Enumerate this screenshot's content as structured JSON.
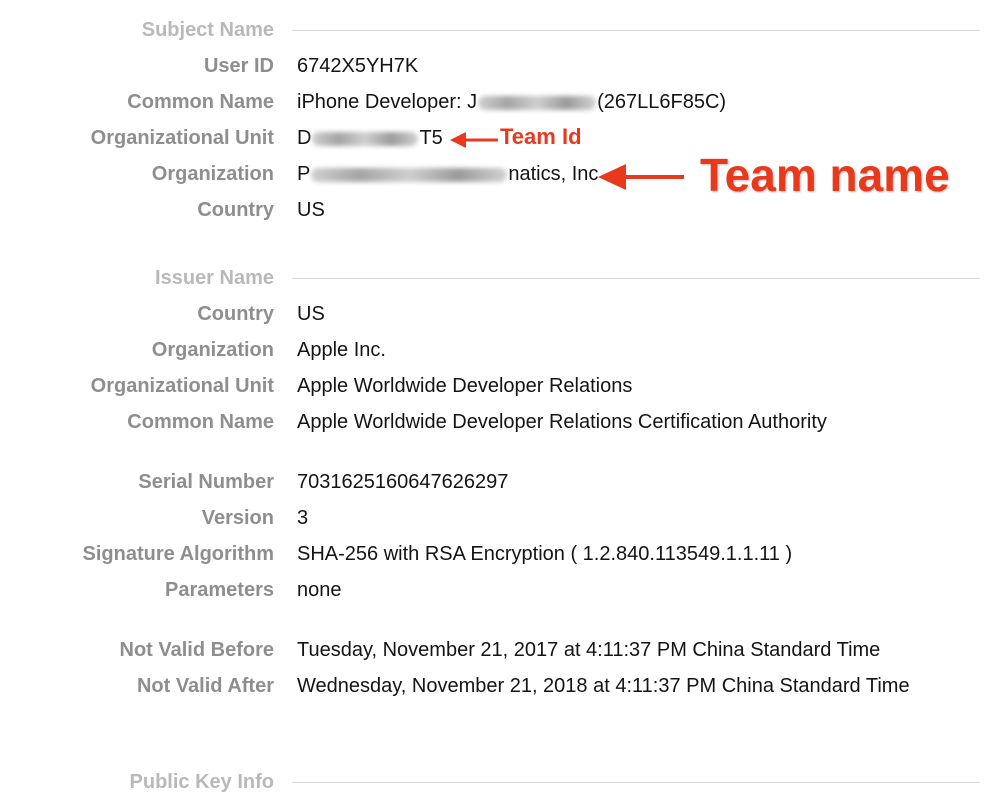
{
  "subject": {
    "section_title": "Subject Name",
    "fields": [
      {
        "key": "User ID",
        "value": "6742X5YH7K"
      },
      {
        "key": "Common Name",
        "value_prefix": "iPhone Developer: J",
        "value_suffix": "(267LL6F85C)"
      },
      {
        "key": "Organizational Unit",
        "value_prefix": "D",
        "value_suffix": "T5"
      },
      {
        "key": "Organization",
        "value_prefix": "P",
        "value_suffix": "natics, Inc"
      },
      {
        "key": "Country",
        "value": "US"
      }
    ]
  },
  "issuer": {
    "section_title": "Issuer Name",
    "fields": [
      {
        "key": "Country",
        "value": "US"
      },
      {
        "key": "Organization",
        "value": "Apple Inc."
      },
      {
        "key": "Organizational Unit",
        "value": "Apple Worldwide Developer Relations"
      },
      {
        "key": "Common Name",
        "value": "Apple Worldwide Developer Relations Certification Authority"
      }
    ]
  },
  "details": {
    "fields": [
      {
        "key": "Serial Number",
        "value": "7031625160647626297"
      },
      {
        "key": "Version",
        "value": "3"
      },
      {
        "key": "Signature Algorithm",
        "value": "SHA-256 with RSA Encryption ( 1.2.840.113549.1.1.11 )"
      },
      {
        "key": "Parameters",
        "value": "none"
      }
    ]
  },
  "validity": {
    "fields": [
      {
        "key": "Not Valid Before",
        "value": "Tuesday, November 21, 2017 at 4:11:37 PM China Standard Time"
      },
      {
        "key": "Not Valid After",
        "value": "Wednesday, November 21, 2018 at 4:11:37 PM China Standard Time"
      }
    ]
  },
  "public_key": {
    "section_title": "Public Key Info"
  },
  "annotations": {
    "team_id_label": "Team Id",
    "team_name_label": "Team name",
    "color": "#e8391d"
  }
}
